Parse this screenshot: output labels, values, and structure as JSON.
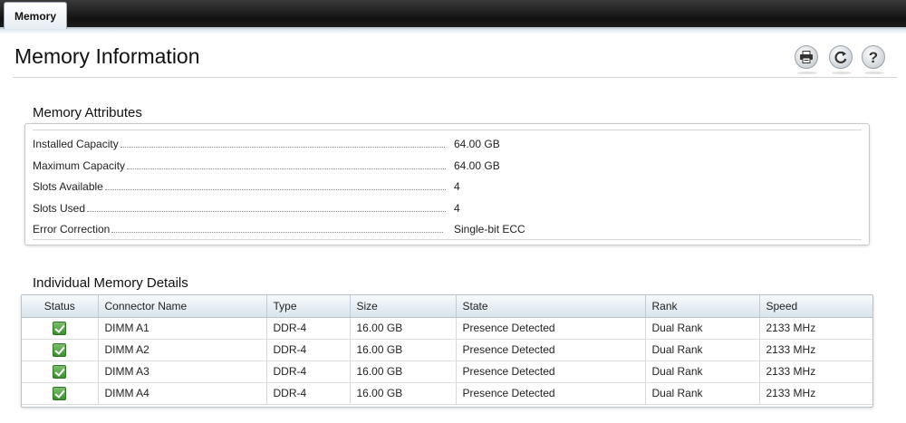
{
  "tabs": [
    {
      "label": "Memory",
      "active": true
    }
  ],
  "page": {
    "title": "Memory Information"
  },
  "toolbar": {
    "print_icon": "printer-icon",
    "refresh_icon": "refresh-icon",
    "help_label": "?"
  },
  "attributes": {
    "title": "Memory Attributes",
    "rows": [
      {
        "label": "Installed Capacity",
        "value": "64.00 GB"
      },
      {
        "label": "Maximum Capacity",
        "value": "64.00 GB"
      },
      {
        "label": "Slots Available",
        "value": "4"
      },
      {
        "label": "Slots Used",
        "value": "4"
      },
      {
        "label": "Error Correction",
        "value": "Single-bit ECC"
      }
    ]
  },
  "details": {
    "title": "Individual Memory Details",
    "columns": [
      "Status",
      "Connector Name",
      "Type",
      "Size",
      "State",
      "Rank",
      "Speed"
    ],
    "rows": [
      {
        "status_icon": "green-check-icon",
        "connector": "DIMM A1",
        "type": "DDR-4",
        "size": "16.00 GB",
        "state": "Presence Detected",
        "rank": "Dual Rank",
        "speed": "2133 MHz"
      },
      {
        "status_icon": "green-check-icon",
        "connector": "DIMM A2",
        "type": "DDR-4",
        "size": "16.00 GB",
        "state": "Presence Detected",
        "rank": "Dual Rank",
        "speed": "2133 MHz"
      },
      {
        "status_icon": "green-check-icon",
        "connector": "DIMM A3",
        "type": "DDR-4",
        "size": "16.00 GB",
        "state": "Presence Detected",
        "rank": "Dual Rank",
        "speed": "2133 MHz"
      },
      {
        "status_icon": "green-check-icon",
        "connector": "DIMM A4",
        "type": "DDR-4",
        "size": "16.00 GB",
        "state": "Presence Detected",
        "rank": "Dual Rank",
        "speed": "2133 MHz"
      }
    ]
  },
  "colors": {
    "tabbar": "#111111",
    "header_gradient": "#d9e4ec",
    "check_green": "#3d8f2f"
  }
}
